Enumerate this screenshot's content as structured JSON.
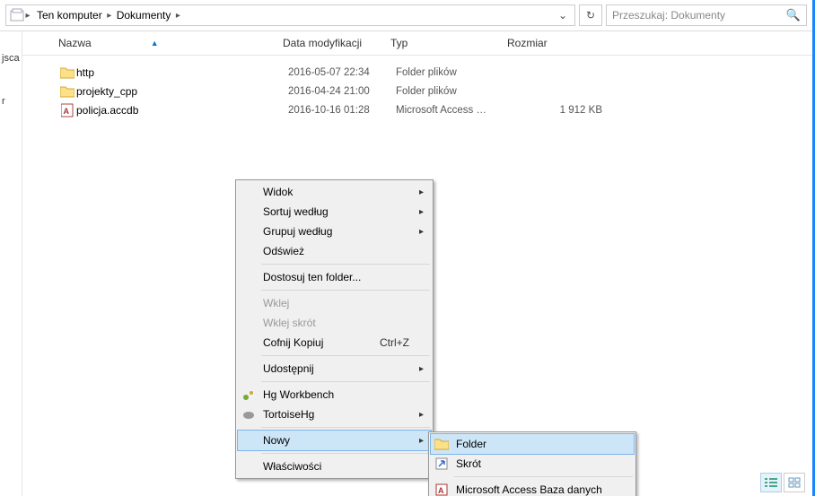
{
  "breadcrumbs": {
    "root": "Ten komputer",
    "current": "Dokumenty"
  },
  "search": {
    "placeholder": "Przeszukaj: Dokumenty"
  },
  "sidebar": {
    "items": [
      "jsca",
      "r"
    ]
  },
  "columns": {
    "name": "Nazwa",
    "date": "Data modyfikacji",
    "type": "Typ",
    "size": "Rozmiar"
  },
  "files": [
    {
      "icon": "folder",
      "name": "http",
      "date": "2016-05-07 22:34",
      "type": "Folder plików",
      "size": ""
    },
    {
      "icon": "folder",
      "name": "projekty_cpp",
      "date": "2016-04-24 21:00",
      "type": "Folder plików",
      "size": ""
    },
    {
      "icon": "access",
      "name": "policja.accdb",
      "date": "2016-10-16 01:28",
      "type": "Microsoft Access …",
      "size": "1 912 KB"
    }
  ],
  "context": {
    "widok": "Widok",
    "sortuj": "Sortuj według",
    "grupuj": "Grupuj według",
    "odswiez": "Odśwież",
    "dostosuj": "Dostosuj ten folder...",
    "wklej": "Wklej",
    "wklejskrot": "Wklej skrót",
    "cofnij": "Cofnij Kopiuj",
    "cofnij_sc": "Ctrl+Z",
    "udostepnij": "Udostępnij",
    "hgwb": "Hg Workbench",
    "thg": "TortoiseHg",
    "nowy": "Nowy",
    "wlasc": "Właściwości"
  },
  "submenu": {
    "folder": "Folder",
    "skrot": "Skrót",
    "access": "Microsoft Access Baza danych"
  }
}
